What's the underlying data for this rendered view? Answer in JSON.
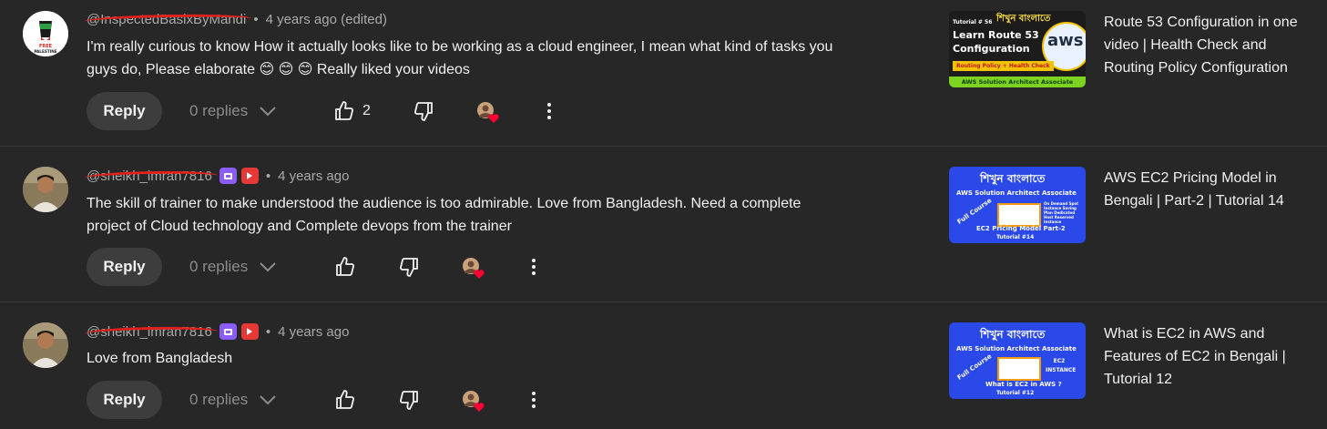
{
  "comments": [
    {
      "handle": "@InspectedBasixByMandi",
      "time": "4 years ago (edited)",
      "text": "I'm really curious to know How it actually looks like to be working as a cloud engineer, I mean what kind of tasks you guys do, Please elaborate 😊 😊 😊 Really liked your videos",
      "reply_label": "Reply",
      "replies_label": "0 replies",
      "like_count": "2",
      "avatar_text": "FREE PALESTINE"
    },
    {
      "handle": "@sheikh_imran7816",
      "time": "4 years ago",
      "text": "The skill of trainer to make understood the audience is too admirable. Love from Bangladesh. Need a complete project of Cloud technology and Complete devops from the trainer",
      "reply_label": "Reply",
      "replies_label": "0 replies",
      "like_count": ""
    },
    {
      "handle": "@sheikh_imran7816",
      "time": "4 years ago",
      "text": "Love from Bangladesh",
      "reply_label": "Reply",
      "replies_label": "0 replies",
      "like_count": ""
    }
  ],
  "videos": [
    {
      "title": "Route 53 Configuration in one video | Health Check and Routing Policy Configuration",
      "thumb": {
        "tutorial": "Tutorial # 56",
        "bangla": "শিখুন বাংলাতে",
        "line1": "Learn Route 53",
        "line2": "Configuration",
        "logo": "aws",
        "tag": "Routing Policy + Health Check",
        "footer": "AWS Solution Architect Associate"
      }
    },
    {
      "title": "AWS EC2 Pricing Model in Bengali | Part-2 | Tutorial 14",
      "thumb": {
        "bangla": "শিখুন বাংলাতে",
        "course": "AWS Solution Architect Associate",
        "side": "Full Course",
        "list": "On Demand Spot Instance Saving Plan Dedicated Host Reserved Instance",
        "caption": "EC2 Pricing Model Part-2",
        "tutorial": "Tutorial #14"
      }
    },
    {
      "title": "What is EC2 in AWS and Features of EC2 in Bengali | Tutorial 12",
      "thumb": {
        "bangla": "শিখুন বাংলাতে",
        "course": "AWS Solution Architect Associate",
        "side": "Full Course",
        "list": "EC2 INSTANCE",
        "caption": "What is EC2 in AWS ?",
        "tutorial": "Tutorial #12"
      }
    }
  ],
  "colors": {
    "background": "#272727",
    "text": "#f1f1f1",
    "muted": "#aaaaaa",
    "heart": "#ff0033",
    "thumb_blue": "#2a49e8"
  }
}
